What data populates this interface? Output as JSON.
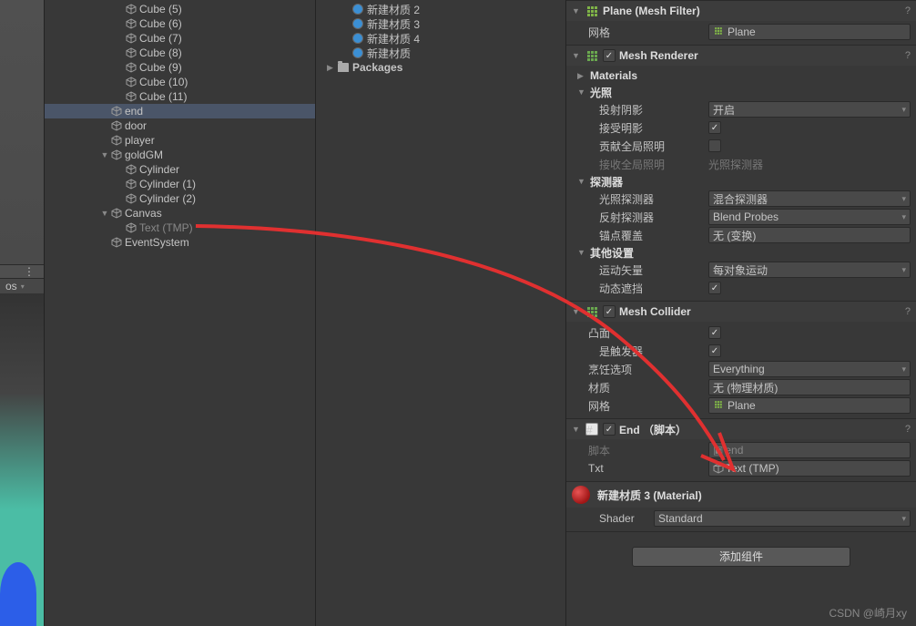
{
  "hierarchy": {
    "items": [
      {
        "label": "Cube (5)",
        "indent": 3
      },
      {
        "label": "Cube (6)",
        "indent": 3
      },
      {
        "label": "Cube (7)",
        "indent": 3
      },
      {
        "label": "Cube (8)",
        "indent": 3
      },
      {
        "label": "Cube (9)",
        "indent": 3
      },
      {
        "label": "Cube (10)",
        "indent": 3
      },
      {
        "label": "Cube (11)",
        "indent": 3
      },
      {
        "label": "end",
        "indent": 2,
        "selected": true
      },
      {
        "label": "door",
        "indent": 2
      },
      {
        "label": "player",
        "indent": 2
      },
      {
        "label": "goldGM",
        "indent": 2,
        "toggle": "▼"
      },
      {
        "label": "Cylinder",
        "indent": 3
      },
      {
        "label": "Cylinder (1)",
        "indent": 3
      },
      {
        "label": "Cylinder (2)",
        "indent": 3
      },
      {
        "label": "Canvas",
        "indent": 2,
        "toggle": "▼"
      },
      {
        "label": "Text (TMP)",
        "indent": 3,
        "dim": true
      },
      {
        "label": "EventSystem",
        "indent": 2
      }
    ]
  },
  "project": {
    "materials": [
      {
        "label": "新建材质 2"
      },
      {
        "label": "新建材质 3"
      },
      {
        "label": "新建材质 4"
      },
      {
        "label": "新建材质"
      }
    ],
    "packages_label": "Packages"
  },
  "gizmo_label": "os",
  "inspector": {
    "mesh_filter": {
      "title": "Plane (Mesh Filter)",
      "mesh_label": "网格",
      "mesh_value": "Plane"
    },
    "mesh_renderer": {
      "title": "Mesh Renderer",
      "materials": "Materials",
      "lighting": "光照",
      "cast_shadows_label": "投射阴影",
      "cast_shadows_value": "开启",
      "receive_shadows_label": "接受明影",
      "global_illum_label": "贡献全局照明",
      "receive_gi_label": "接收全局照明",
      "receive_gi_value": "光照探测器",
      "probes": "探测器",
      "light_probes_label": "光照探测器",
      "light_probes_value": "混合探测器",
      "reflection_probes_label": "反射探测器",
      "reflection_probes_value": "Blend Probes",
      "anchor_label": "锚点覆盖",
      "anchor_value": "无 (变换)",
      "additional": "其他设置",
      "motion_label": "运动矢量",
      "motion_value": "每对象运动",
      "dynamic_occ_label": "动态遮挡"
    },
    "mesh_collider": {
      "title": "Mesh Collider",
      "convex_label": "凸面",
      "trigger_label": "是触发器",
      "cooking_label": "烹饪选项",
      "cooking_value": "Everything",
      "material_label": "材质",
      "material_value": "无 (物理材质)",
      "mesh_label": "网格",
      "mesh_value": "Plane"
    },
    "end_script": {
      "title": "End （脚本）",
      "script_label": "脚本",
      "script_value": "end",
      "txt_label": "Txt",
      "txt_value": "Text (TMP)"
    },
    "material": {
      "title": "新建材质 3 (Material)",
      "shader_label": "Shader",
      "shader_value": "Standard"
    },
    "add_component": "添加组件"
  },
  "watermark": "CSDN @崎月xy"
}
